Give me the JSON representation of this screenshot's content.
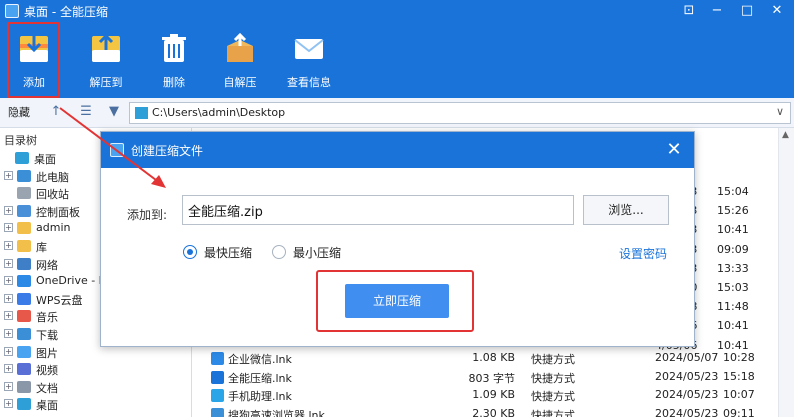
{
  "window": {
    "title": "桌面 - 全能压缩",
    "controls": [
      "⊡",
      "−",
      "□",
      "✕"
    ]
  },
  "toolbar": {
    "buttons": [
      {
        "label": "添加",
        "icon": "add-archive-icon"
      },
      {
        "label": "解压到",
        "icon": "extract-to-icon"
      },
      {
        "label": "删除",
        "icon": "delete-icon"
      },
      {
        "label": "自解压",
        "icon": "sfx-icon"
      },
      {
        "label": "查看信息",
        "icon": "info-mail-icon"
      }
    ]
  },
  "nav": {
    "hide_label": "隐藏",
    "path": "C:\\Users\\admin\\Desktop"
  },
  "tree": {
    "header": "目录树",
    "items": [
      {
        "label": "桌面",
        "color": "#2f9fd8"
      },
      {
        "label": "此电脑",
        "color": "#3b8fd6"
      },
      {
        "label": "回收站",
        "color": "#9aa4b0"
      },
      {
        "label": "控制面板",
        "color": "#4a90d9"
      },
      {
        "label": "admin",
        "color": "#f2c04a"
      },
      {
        "label": "库",
        "color": "#f2c04a"
      },
      {
        "label": "网络",
        "color": "#3f7fc7"
      },
      {
        "label": "OneDrive - P",
        "color": "#2c8ae6"
      },
      {
        "label": "WPS云盘",
        "color": "#3a7be8"
      },
      {
        "label": "音乐",
        "color": "#e8584a"
      },
      {
        "label": "下载",
        "color": "#3b8fd6"
      },
      {
        "label": "图片",
        "color": "#4aa3f0"
      },
      {
        "label": "视频",
        "color": "#5a6fd6"
      },
      {
        "label": "文档",
        "color": "#8a97a8"
      },
      {
        "label": "桌面",
        "color": "#2f9fd8"
      }
    ]
  },
  "right_times": [
    {
      "date": "4/05/23",
      "time": "15:04"
    },
    {
      "date": "4/05/23",
      "time": "15:26"
    },
    {
      "date": "4/05/23",
      "time": "10:41"
    },
    {
      "date": "4/05/23",
      "time": "09:09"
    },
    {
      "date": "4/05/23",
      "time": "13:33"
    },
    {
      "date": "4/05/20",
      "time": "15:03"
    },
    {
      "date": "4/05/08",
      "time": "11:48"
    },
    {
      "date": "4/05/06",
      "time": "10:41"
    },
    {
      "date": "4/05/06",
      "time": "10:41"
    }
  ],
  "files": [
    {
      "name": "企业微信.lnk",
      "size": "1.08 KB",
      "type": "快捷方式",
      "date": "2024/05/07",
      "time": "10:28",
      "color": "#2c8ae6"
    },
    {
      "name": "全能压缩.lnk",
      "size": "803 字节",
      "type": "快捷方式",
      "date": "2024/05/23",
      "time": "15:18",
      "color": "#1a73d9"
    },
    {
      "name": "手机助理.lnk",
      "size": "1.09 KB",
      "type": "快捷方式",
      "date": "2024/05/23",
      "time": "10:07",
      "color": "#2aa5e8"
    },
    {
      "name": "搜狗高速浏览器.lnk",
      "size": "2.30 KB",
      "type": "快捷方式",
      "date": "2024/05/23",
      "time": "09:11",
      "color": "#3b8fd6"
    }
  ],
  "dialog": {
    "title": "创建压缩文件",
    "add_to_label": "添加到:",
    "path_value": "全能压缩.zip",
    "browse_label": "浏览...",
    "options": [
      {
        "label": "最快压缩",
        "selected": true
      },
      {
        "label": "最小压缩",
        "selected": false
      }
    ],
    "password_link": "设置密码",
    "compress_label": "立即压缩"
  },
  "colors": {
    "accent": "#1a73d9",
    "highlight": "#e23434",
    "primary_button": "#3f8ef0"
  }
}
